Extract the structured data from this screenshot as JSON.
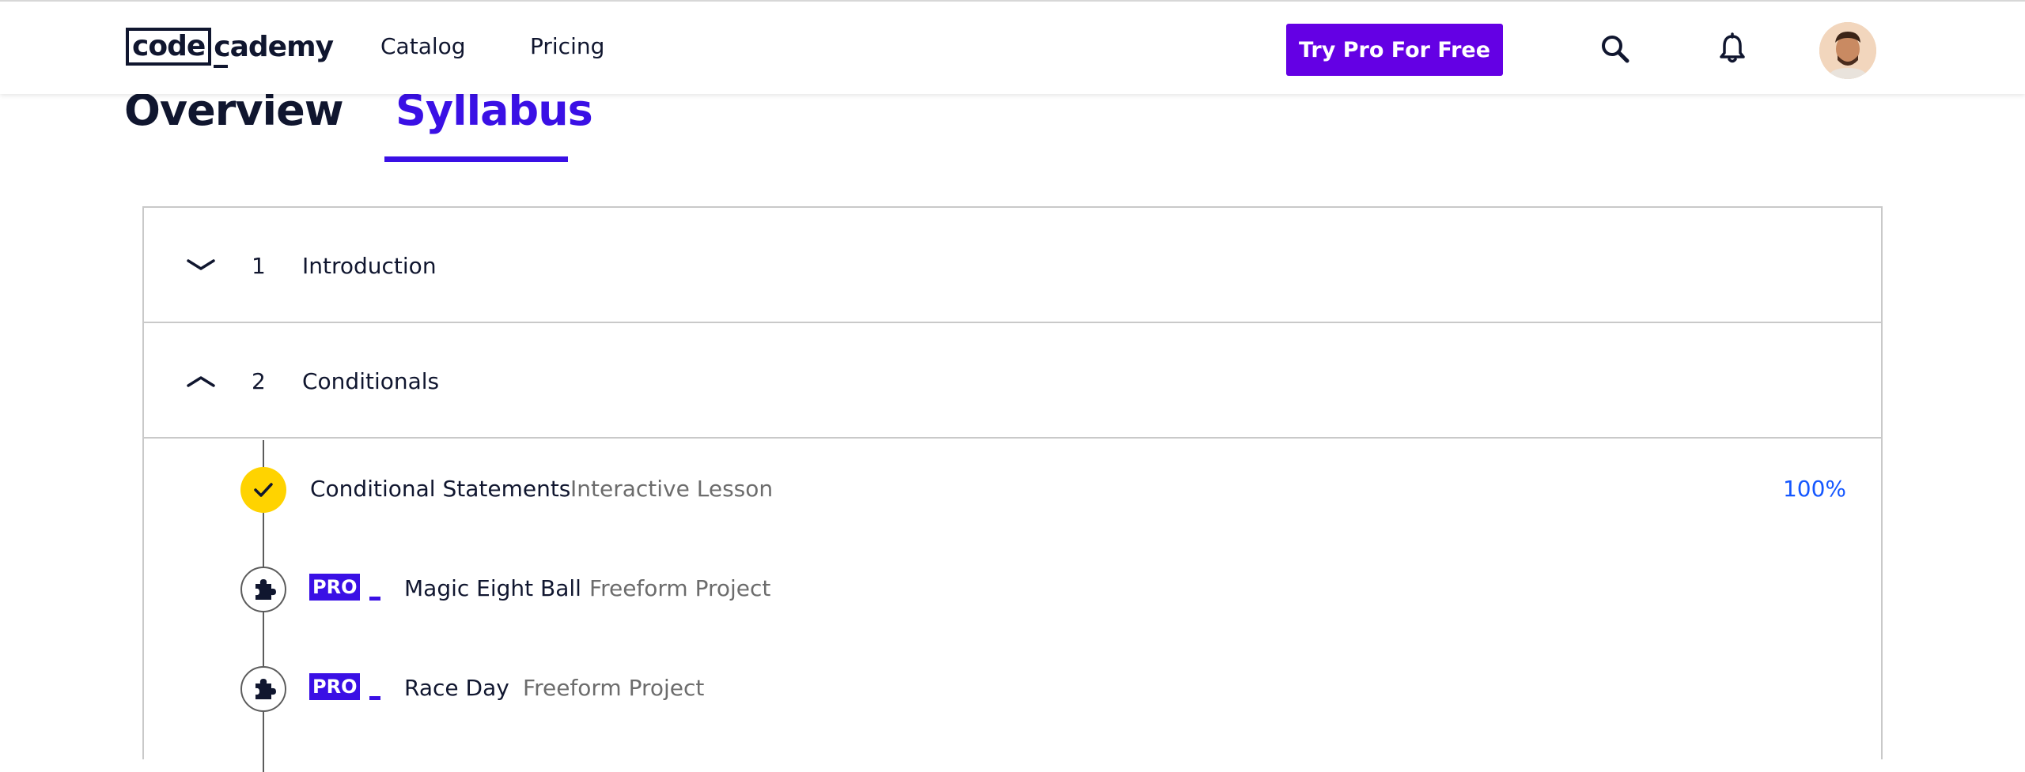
{
  "header": {
    "logo_boxed": "code",
    "logo_rest": "cademy",
    "nav": {
      "catalog": "Catalog",
      "pricing": "Pricing"
    },
    "cta_label": "Try Pro For Free",
    "icons": [
      "search-icon",
      "bell-icon"
    ]
  },
  "tabs": {
    "overview": "Overview",
    "syllabus": "Syllabus",
    "active": "syllabus"
  },
  "modules": [
    {
      "number": "1",
      "title": "Introduction",
      "expanded": false
    },
    {
      "number": "2",
      "title": "Conditionals",
      "expanded": true
    }
  ],
  "lessons": [
    {
      "title": "Conditional Statements",
      "type": "Interactive Lesson",
      "progress": "100%",
      "status": "complete"
    },
    {
      "badge": "PRO",
      "title": "Magic Eight Ball",
      "type": "Freeform Project",
      "status": "project"
    },
    {
      "badge": "PRO",
      "title": "Race Day",
      "type": "Freeform Project",
      "status": "project"
    }
  ],
  "colors": {
    "brand_purple": "#6400e4",
    "accent": "#3a10e5",
    "complete_yellow": "#ffd300",
    "progress_blue": "#1557ff",
    "text_dark": "#10162f"
  }
}
